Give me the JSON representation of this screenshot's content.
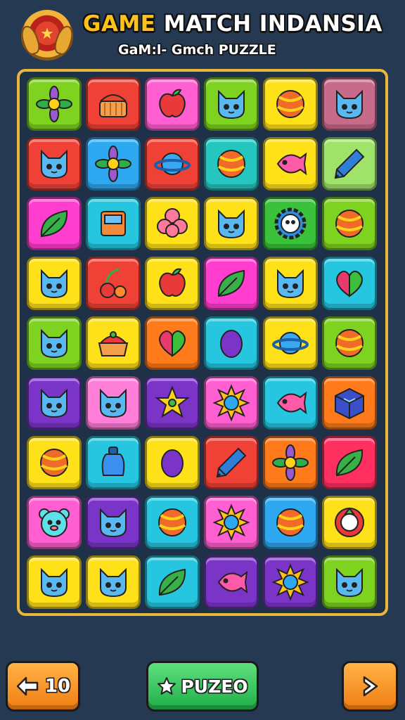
{
  "header": {
    "title_word1": "GAME",
    "title_rest": " MATCH INDANSIA",
    "subtitle": "GaM:l- Gmch PUZZLE",
    "logo_icon": "emblem-icon"
  },
  "board": {
    "rows": 9,
    "columns": 6,
    "tiles": [
      {
        "bg": "#7ed321",
        "icon": "flower-icon"
      },
      {
        "bg": "#ef4135",
        "icon": "basket-icon"
      },
      {
        "bg": "#ff5fd0",
        "icon": "apple-icon"
      },
      {
        "bg": "#7ed321",
        "icon": "cat-icon"
      },
      {
        "bg": "#ffe11a",
        "icon": "ball-icon"
      },
      {
        "bg": "#c86b8a",
        "icon": "cat-icon"
      },
      {
        "bg": "#ef4135",
        "icon": "cat-icon"
      },
      {
        "bg": "#2fa8f2",
        "icon": "flower-icon"
      },
      {
        "bg": "#ef4135",
        "icon": "planet-icon"
      },
      {
        "bg": "#26c6c0",
        "icon": "ball-icon"
      },
      {
        "bg": "#ffe11a",
        "icon": "fish-icon"
      },
      {
        "bg": "#9fe36a",
        "icon": "pencil-icon"
      },
      {
        "bg": "#ff3ecf",
        "icon": "leaf-icon"
      },
      {
        "bg": "#26c6e0",
        "icon": "square-icon"
      },
      {
        "bg": "#ffe11a",
        "icon": "clover-icon"
      },
      {
        "bg": "#ffe11a",
        "icon": "cat-icon"
      },
      {
        "bg": "#39c23a",
        "icon": "gear-icon"
      },
      {
        "bg": "#7ed321",
        "icon": "ball-icon"
      },
      {
        "bg": "#ffe11a",
        "icon": "cat-icon"
      },
      {
        "bg": "#ef4135",
        "icon": "cherry-icon"
      },
      {
        "bg": "#ffe11a",
        "icon": "apple-icon"
      },
      {
        "bg": "#ff3ecf",
        "icon": "leaf-icon"
      },
      {
        "bg": "#ffe11a",
        "icon": "cat-icon"
      },
      {
        "bg": "#26c6e0",
        "icon": "heart-icon"
      },
      {
        "bg": "#7ed321",
        "icon": "cat-icon"
      },
      {
        "bg": "#ffe11a",
        "icon": "cake-icon"
      },
      {
        "bg": "#ff7a1a",
        "icon": "heart-icon"
      },
      {
        "bg": "#26c6e0",
        "icon": "egg-icon"
      },
      {
        "bg": "#ffe11a",
        "icon": "planet-icon"
      },
      {
        "bg": "#7ed321",
        "icon": "ball-icon"
      },
      {
        "bg": "#7a35c8",
        "icon": "cat-icon"
      },
      {
        "bg": "#ff7ed8",
        "icon": "cat-icon"
      },
      {
        "bg": "#7a35c8",
        "icon": "star-icon"
      },
      {
        "bg": "#ff5fd0",
        "icon": "sun-icon"
      },
      {
        "bg": "#26c6e0",
        "icon": "fish-icon"
      },
      {
        "bg": "#ff7a1a",
        "icon": "box-icon"
      },
      {
        "bg": "#ffe11a",
        "icon": "ball-icon"
      },
      {
        "bg": "#26c6e0",
        "icon": "bottle-icon"
      },
      {
        "bg": "#ffe11a",
        "icon": "egg-icon"
      },
      {
        "bg": "#ef4135",
        "icon": "pencil-icon"
      },
      {
        "bg": "#ff7a1a",
        "icon": "flower-icon"
      },
      {
        "bg": "#ff3060",
        "icon": "leaf-icon"
      },
      {
        "bg": "#ff5fd0",
        "icon": "bear-icon"
      },
      {
        "bg": "#7a35c8",
        "icon": "cat-icon"
      },
      {
        "bg": "#26c6e0",
        "icon": "ball-icon"
      },
      {
        "bg": "#ff5fd0",
        "icon": "sun-icon"
      },
      {
        "bg": "#2fa8f2",
        "icon": "ball-icon"
      },
      {
        "bg": "#ffe11a",
        "icon": "ring-icon"
      },
      {
        "bg": "#ffe11a",
        "icon": "cat-icon"
      },
      {
        "bg": "#ffe11a",
        "icon": "cat-icon"
      },
      {
        "bg": "#26c6e0",
        "icon": "leaf-icon"
      },
      {
        "bg": "#7a35c8",
        "icon": "fish-icon"
      },
      {
        "bg": "#7a35c8",
        "icon": "sun-icon"
      },
      {
        "bg": "#7ed321",
        "icon": "cat-icon"
      }
    ]
  },
  "controls": {
    "back_label": "10",
    "back_icon": "arrow-left-icon",
    "center_label": "PUZEO",
    "center_icon": "star-icon",
    "next_icon": "chevron-right-icon"
  }
}
